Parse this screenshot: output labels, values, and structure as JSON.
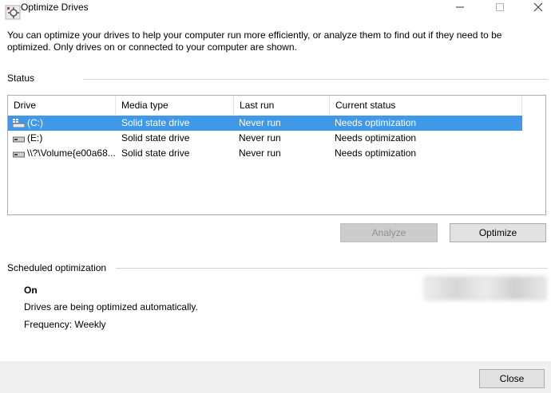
{
  "window": {
    "title": "Optimize Drives"
  },
  "description": "You can optimize your drives to help your computer run more efficiently, or analyze them to find out if they need to be optimized. Only drives on or connected to your computer are shown.",
  "status": {
    "label": "Status",
    "columns": [
      "Drive",
      "Media type",
      "Last run",
      "Current status"
    ],
    "rows": [
      {
        "drive": "(C:)",
        "media": "Solid state drive",
        "last_run": "Never run",
        "status": "Needs optimization",
        "icon": "windows-drive-icon",
        "selected": true
      },
      {
        "drive": "(E:)",
        "media": "Solid state drive",
        "last_run": "Never run",
        "status": "Needs optimization",
        "icon": "drive-icon",
        "selected": false
      },
      {
        "drive": "\\\\?\\Volume{e00a68...",
        "media": "Solid state drive",
        "last_run": "Never run",
        "status": "Needs optimization",
        "icon": "drive-icon",
        "selected": false
      }
    ],
    "analyze_label": "Analyze",
    "optimize_label": "Optimize"
  },
  "scheduled": {
    "label": "Scheduled optimization",
    "state": "On",
    "description": "Drives are being optimized automatically.",
    "frequency": "Frequency: Weekly"
  },
  "footer": {
    "close_label": "Close"
  },
  "watermark": {
    "text": "JZSU绿色下载",
    "url": "www.jz5u.com"
  },
  "colors": {
    "selection": "#3f98e8",
    "window_bg": "#ffffff",
    "footer_bg": "#f0f0f0"
  }
}
